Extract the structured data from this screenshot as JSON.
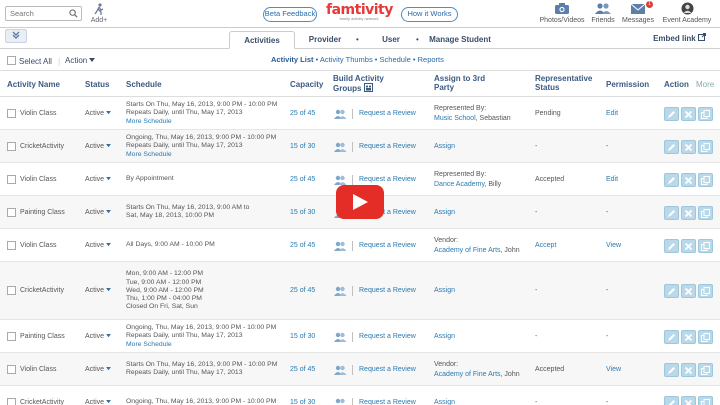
{
  "header": {
    "search_placeholder": "Search",
    "add_label": "Add+",
    "beta_feedback": "Beta Feedback",
    "logo_text": "famtivity",
    "logo_tagline": "family activity network",
    "how_it_works": "How it Works",
    "icons": [
      {
        "label": "Photos/Videos",
        "icon": "camera-icon"
      },
      {
        "label": "Friends",
        "icon": "friends-icon"
      },
      {
        "label": "Messages",
        "icon": "envelope-icon",
        "badge": "1"
      },
      {
        "label": "Event Academy",
        "icon": "user-avatar-icon"
      }
    ]
  },
  "nav": {
    "tabs": [
      "Activities",
      "Provider",
      "User",
      "Manage Student"
    ],
    "active_tab": "Activities",
    "embed_link": "Embed link"
  },
  "subnav": {
    "items": [
      "Activity List",
      "Activity Thumbs",
      "Schedule",
      "Reports"
    ],
    "active": "Activity List"
  },
  "toolbar": {
    "select_all": "Select All",
    "action": "Action"
  },
  "table": {
    "headers": {
      "name": "Activity Name",
      "status": "Status",
      "schedule": "Schedule",
      "capacity": "Capacity",
      "groups": "Build Activity Groups",
      "assign": "Assign to 3rd Party",
      "rep": "Representative Status",
      "perm": "Permission",
      "action": "Action",
      "more": "More"
    },
    "rows": [
      {
        "name": "Violin Class",
        "status": "Active",
        "schedule": [
          "Starts On Thu, May 16, 2013, 9:00 PM - 10:00 PM",
          "Repeats Daily, until Thu, May 17, 2013"
        ],
        "more": "More Schedule",
        "capacity": "25 of 45",
        "request": "Request a Review",
        "assign_title": "Represented By:",
        "assign_link": "Music School",
        "assign_rest": ", Sebastian",
        "rep": "Pending",
        "perm": "Edit"
      },
      {
        "name": "CricketActivity",
        "status": "Active",
        "schedule": [
          "Ongoing, Thu, May 16, 2013, 9:00 PM - 10:00 PM",
          "Repeats Daily, until Thu, May 17, 2013"
        ],
        "more": "More Schedule",
        "capacity": "15 of 30",
        "request": "Request a Review",
        "assign_single": "Assign",
        "rep": "-",
        "perm": "-"
      },
      {
        "name": "Violin Class",
        "status": "Active",
        "schedule": [
          "By Appointment"
        ],
        "more": "",
        "capacity": "25 of 45",
        "request": "Request a Review",
        "assign_title": "Represented By:",
        "assign_link": "Dance Academy",
        "assign_rest": ", Billy",
        "rep": "Accepted",
        "perm": "Edit"
      },
      {
        "name": "Painting Class",
        "status": "Active",
        "schedule": [
          "Starts On Thu, May 16, 2013, 9:00 AM to",
          "Sat, May 18, 2013, 10:00 PM"
        ],
        "more": "",
        "capacity": "15 of 30",
        "request": "Request a Review",
        "assign_single": "Assign",
        "rep": "-",
        "perm": "-"
      },
      {
        "name": "Violin Class",
        "status": "Active",
        "schedule": [
          "All Days, 9:00 AM - 10:00 PM"
        ],
        "more": "",
        "capacity": "25 of 45",
        "request": "Request a Review",
        "assign_title": "Vendor:",
        "assign_link": "Academy of Fine Arts",
        "assign_rest": ", John",
        "rep": "Accept",
        "rep_link": true,
        "perm": "View"
      },
      {
        "name": "CricketActivity",
        "status": "Active",
        "schedule": [
          "Mon, 9:00 AM - 12:00 PM",
          "Tue, 9:00 AM - 12:00 PM",
          "Wed, 9:00 AM - 12:00 PM",
          "Thu, 1:00 PM - 04:00 PM",
          "Closed On Fri, Sat, Sun"
        ],
        "more": "",
        "capacity": "25 of 45",
        "request": "Request a Review",
        "assign_single": "Assign",
        "rep": "-",
        "perm": "-"
      },
      {
        "name": "Painting Class",
        "status": "Active",
        "schedule": [
          "Ongoing, Thu, May 16, 2013, 9:00 PM - 10:00 PM",
          "Repeats Daily, until Thu, May 17, 2013"
        ],
        "more": "More Schedule",
        "capacity": "15 of 30",
        "request": "Request a Review",
        "assign_single": "Assign",
        "rep": "-",
        "perm": "-"
      },
      {
        "name": "Violin Class",
        "status": "Active",
        "schedule": [
          "Starts On Thu, May 16, 2013, 9:00 PM - 10:00 PM",
          "Repeats Daily, until Thu, May 17, 2013"
        ],
        "more": "",
        "capacity": "25 of 45",
        "request": "Request a Review",
        "assign_title": "Vendor:",
        "assign_link": "Academy of Fine Arts",
        "assign_rest": ", John",
        "rep": "Accepted",
        "perm": "View"
      },
      {
        "name": "CricketActivity",
        "status": "Active",
        "schedule": [
          "Ongoing, Thu, May 16, 2013, 9:00 PM - 10:00 PM"
        ],
        "more": "",
        "capacity": "15 of 30",
        "request": "Request a Review",
        "assign_single": "Assign",
        "rep": "-",
        "perm": "-"
      }
    ]
  },
  "colors": {
    "accent": "#2a7ab0",
    "logo_red": "#e63a3a",
    "action_btn": "#b9d9ea",
    "play_red": "#e52d27"
  }
}
